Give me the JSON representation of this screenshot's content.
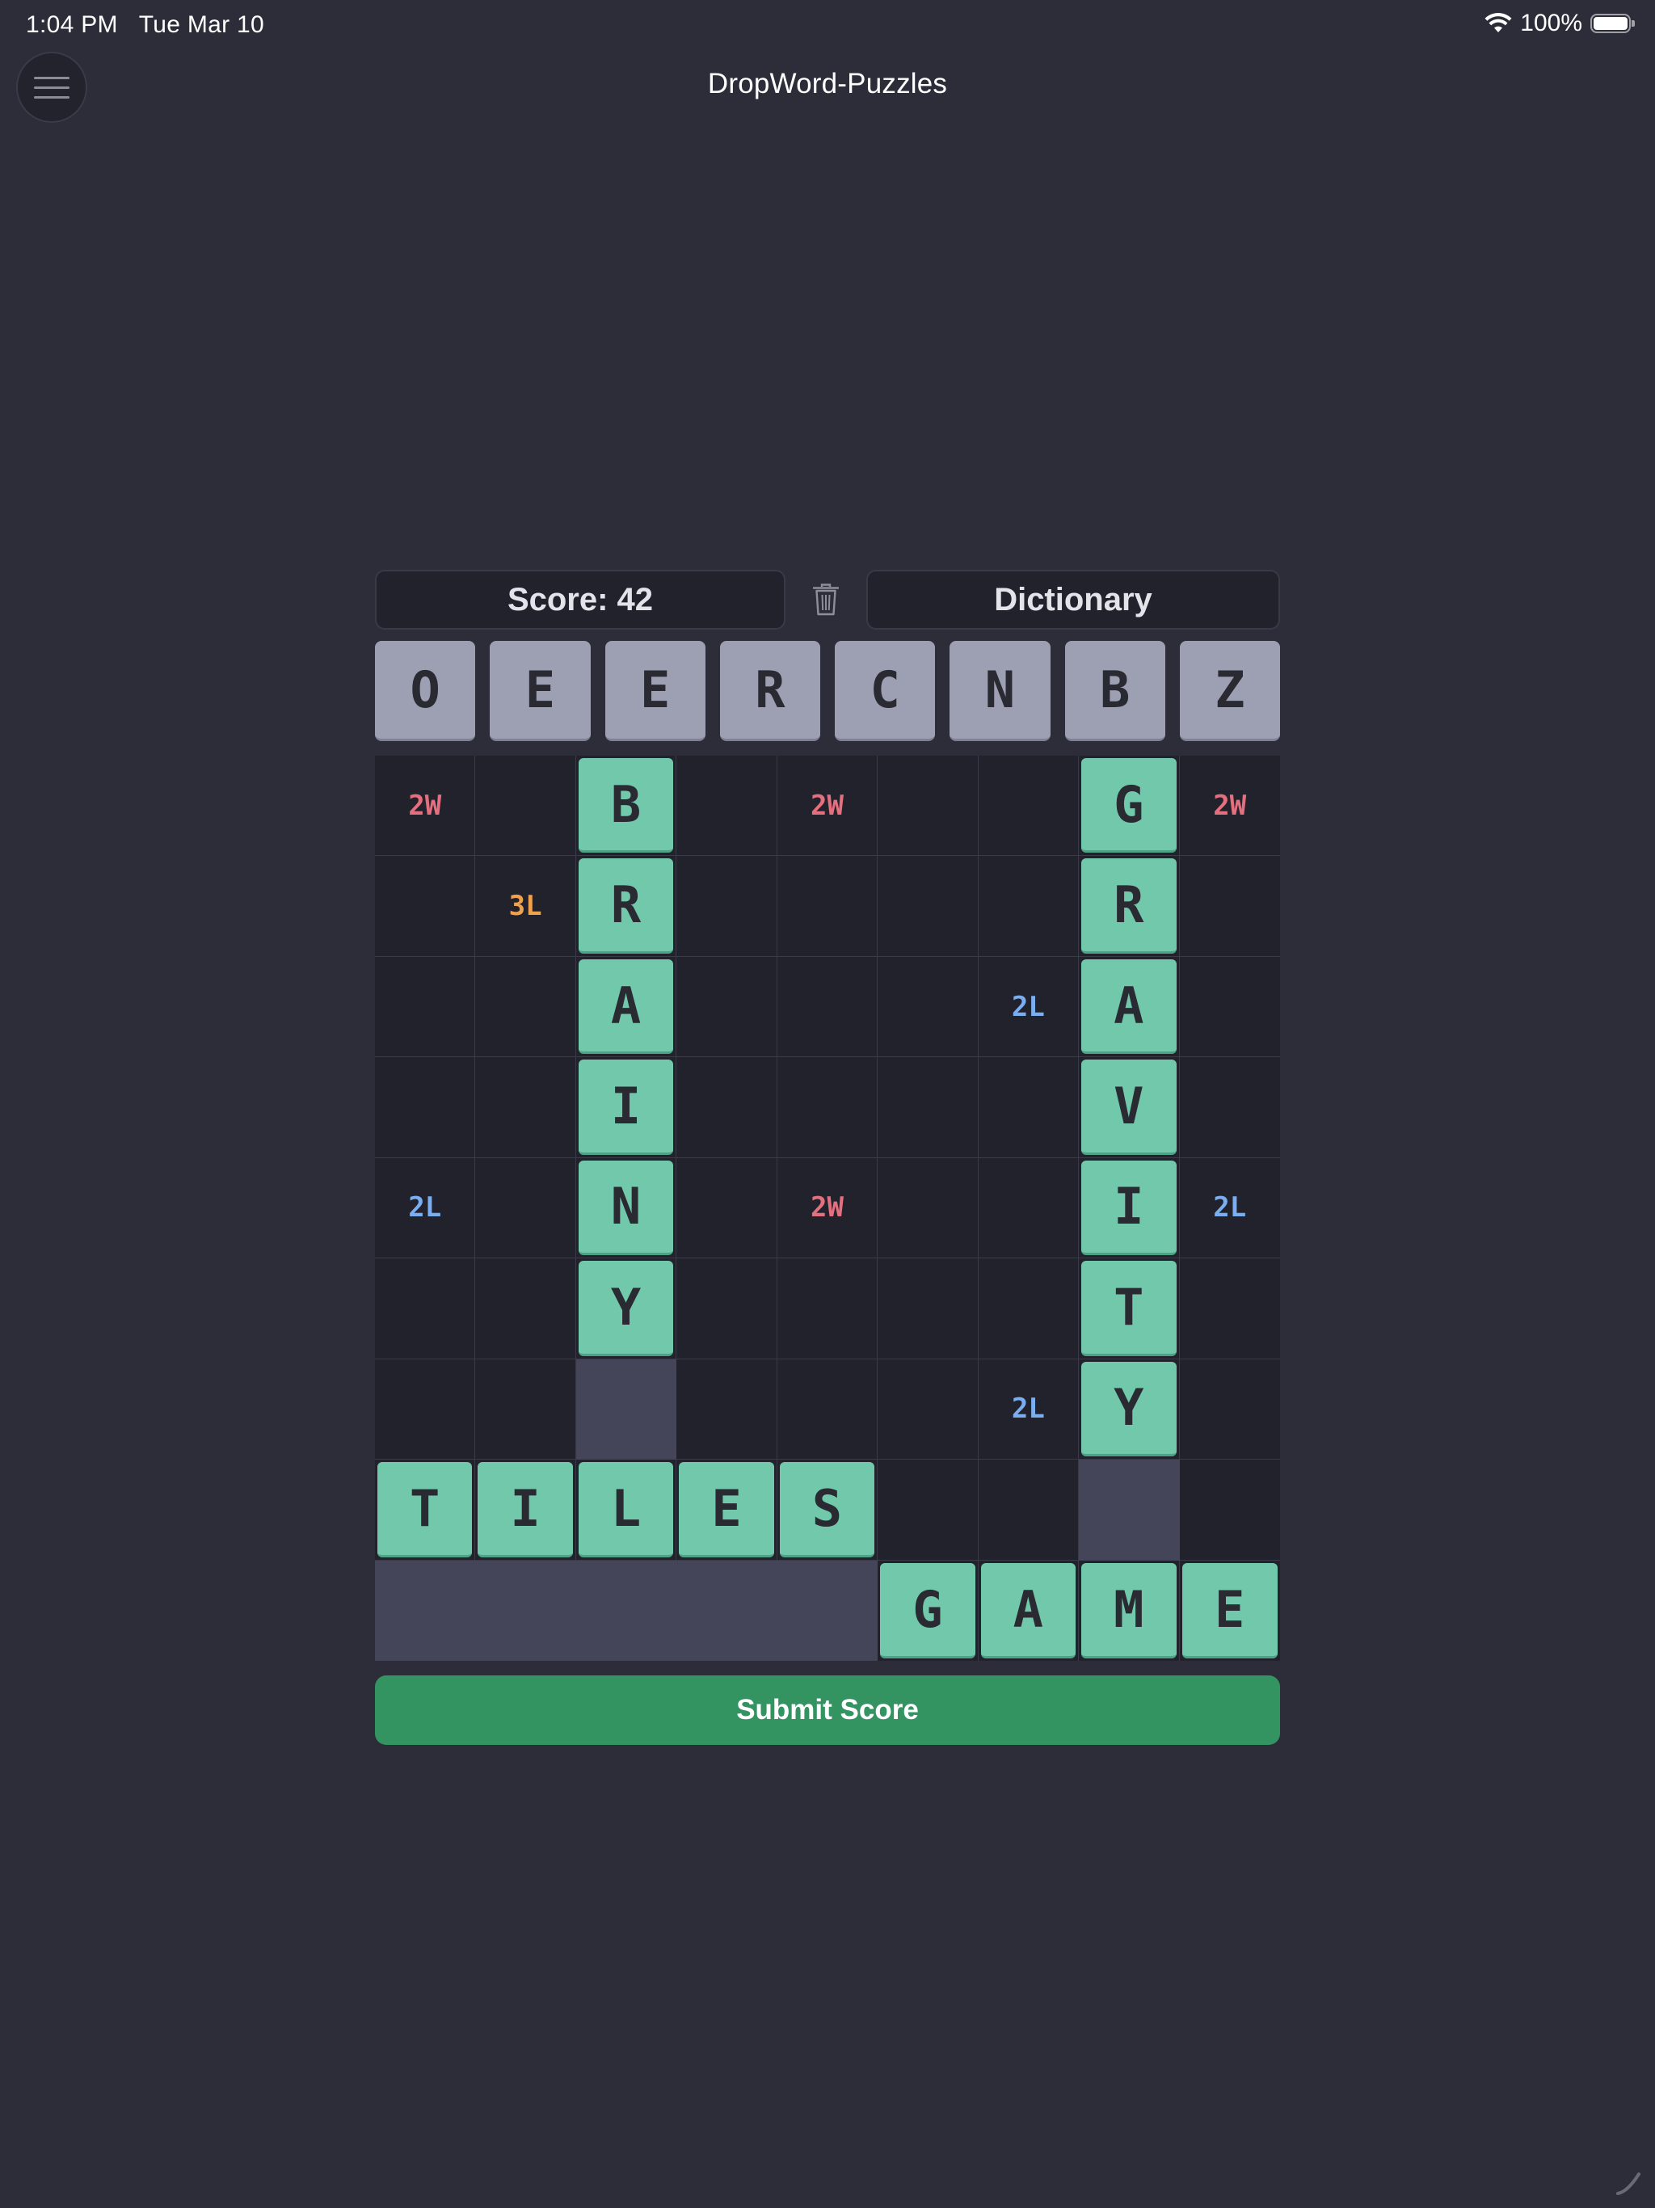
{
  "status_bar": {
    "time": "1:04 PM",
    "date": "Tue Mar 10",
    "battery": "100%"
  },
  "app": {
    "title": "DropWord-Puzzles"
  },
  "header": {
    "score_label": "Score: 42",
    "dictionary_label": "Dictionary"
  },
  "rack": [
    "O",
    "E",
    "E",
    "R",
    "C",
    "N",
    "B",
    "Z"
  ],
  "board": {
    "rows": 9,
    "cols": 9,
    "cells": [
      [
        "2W",
        "",
        "=B",
        "",
        "2W",
        "",
        "",
        "=G",
        "2W"
      ],
      [
        "",
        "3L",
        "=R",
        "",
        "",
        "",
        "",
        "=R",
        ""
      ],
      [
        "",
        "",
        "=A",
        "",
        "",
        "",
        "2L",
        "=A",
        ""
      ],
      [
        "",
        "",
        "=I",
        "",
        "",
        "",
        "",
        "=V",
        ""
      ],
      [
        "2L",
        "",
        "=N",
        "",
        "2W",
        "",
        "",
        "=I",
        "2L"
      ],
      [
        "",
        "",
        "=Y",
        "",
        "",
        "",
        "",
        "=T",
        ""
      ],
      [
        "",
        "",
        "#",
        "",
        "",
        "",
        "2L",
        "=Y",
        ""
      ],
      [
        "=T",
        "=I",
        "=L",
        "=E",
        "=S",
        "",
        "",
        "#",
        ""
      ],
      [
        "#",
        "#",
        "#",
        "#",
        "#",
        "=G",
        "=A",
        "=M",
        "=E"
      ]
    ]
  },
  "submit": {
    "label": "Submit Score"
  },
  "colors": {
    "background": "#2d2d3a",
    "tile": "#72c8aa",
    "rack_tile": "#9da0b2",
    "submit": "#339462",
    "double_word": "#e46f7f",
    "triple_letter": "#f0a14e",
    "double_letter": "#7aaef0"
  }
}
